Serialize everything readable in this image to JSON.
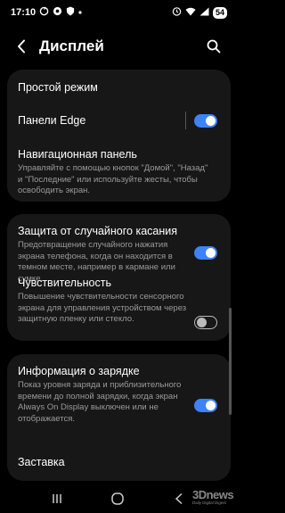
{
  "status_bar": {
    "time": "17:10",
    "battery": "54"
  },
  "header": {
    "title": "Дисплей"
  },
  "cards": {
    "card1": {
      "simple_mode": "Простой режим",
      "edge_panels": {
        "label": "Панели Edge",
        "enabled": true
      },
      "nav_panel": {
        "label": "Навигационная панель",
        "description_line1": "Управляйте с помощью кнопок \"Домой\", \"Назад\"",
        "description_line2": "и \"Последние\" или используйте жесты, чтобы",
        "description_line3": "освободить экран."
      }
    },
    "card2": {
      "accidental_touch": {
        "label": "Защита от случайного касания",
        "description_line1": "Предотвращение случайного нажатия",
        "description_line2": "экрана телефона, когда он находится в",
        "description_line3": "темном месте, например в кармане или",
        "description_line4": "сумке.",
        "enabled": true
      },
      "sensitivity": {
        "label": "Чувствительность",
        "description_line1": "Повышение чувствительности сенсорного",
        "description_line2": "экрана для управления устройством через",
        "description_line3": "защитную пленку или стекло.",
        "enabled": false
      }
    },
    "card3": {
      "charging_info": {
        "label": "Информация о зарядке",
        "description_line1": "Показ уровня заряда и приблизительного",
        "description_line2": "времени до полной зарядки, когда экран",
        "description_line3": "Always On Display выключен или не",
        "description_line4": "отображается.",
        "enabled": true
      },
      "screensaver": "Заставка"
    }
  },
  "watermark": {
    "brand": "3Dnews",
    "tagline": "Daily Digital Digest"
  },
  "colors": {
    "accent": "#3e82f7",
    "card_bg": "#171717"
  }
}
